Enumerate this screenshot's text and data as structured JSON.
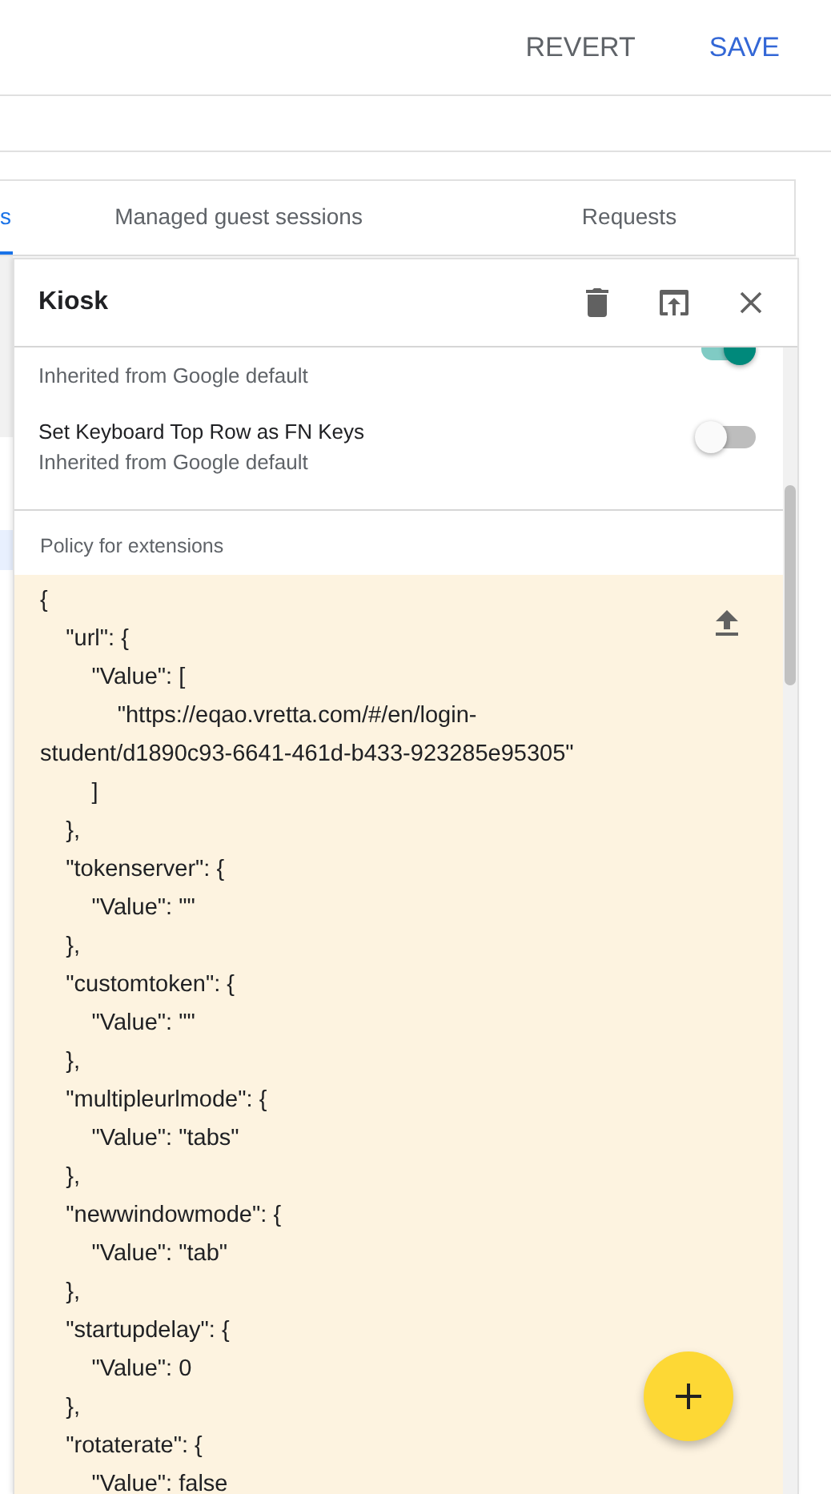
{
  "toolbar": {
    "buttons": [
      {
        "label": "REVERT",
        "kind": "secondary"
      },
      {
        "label": "SAVE",
        "kind": "primary"
      }
    ]
  },
  "tabs": [
    {
      "label": "s",
      "selected": true
    },
    {
      "label": "Managed guest sessions",
      "selected": false
    },
    {
      "label": "Requests",
      "selected": false
    }
  ],
  "list": {
    "rows": [
      {
        "selected": false
      },
      {
        "selected": true
      }
    ]
  },
  "panel": {
    "title": "Kiosk",
    "settings": [
      {
        "subtitle": "Inherited from Google default",
        "on": true
      },
      {
        "label": "Set Keyboard Top Row as FN Keys",
        "subtitle": "Inherited from Google default",
        "on": false
      }
    ],
    "policy_label": "Policy for extensions",
    "policy_code": "{\n    \"url\": {\n        \"Value\": [\n            \"https://eqao.vretta.com/#/en/login-student/d1890c93-6641-461d-b433-923285e95305\"\n        ]\n    },\n    \"tokenserver\": {\n        \"Value\": \"\"\n    },\n    \"customtoken\": {\n        \"Value\": \"\"\n    },\n    \"multipleurlmode\": {\n        \"Value\": \"tabs\"\n    },\n    \"newwindowmode\": {\n        \"Value\": \"tab\"\n    },\n    \"startupdelay\": {\n        \"Value\": 0\n    },\n    \"rotaterate\": {\n        \"Value\": false"
  }
}
